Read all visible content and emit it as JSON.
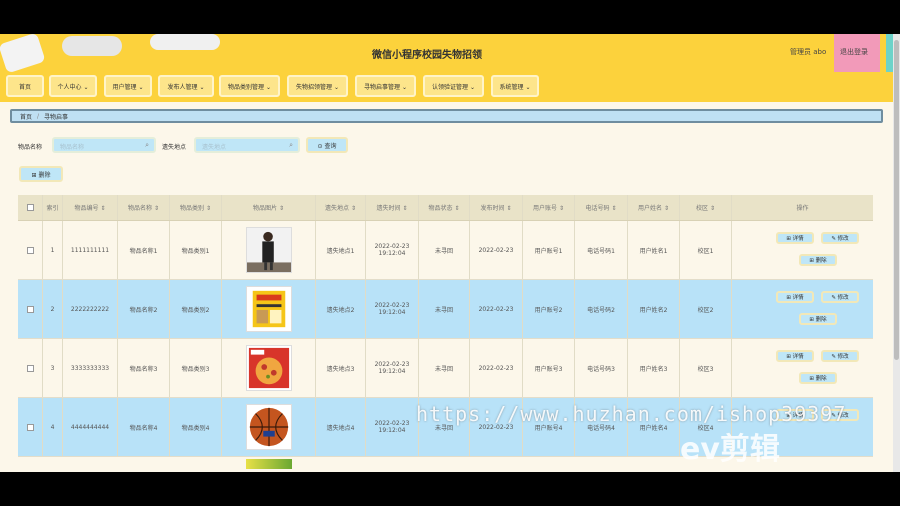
{
  "header": {
    "title": "微信小程序校园失物招领",
    "admin": "管理员 abo",
    "logout": "退出登录"
  },
  "nav": [
    "首页",
    "个人中心 ⌄",
    "用户管理 ⌄",
    "发布人管理 ⌄",
    "物品类别管理 ⌄",
    "失物招领管理 ⌄",
    "寻物启事管理 ⌄",
    "认领验证管理 ⌄",
    "系统管理 ⌄"
  ],
  "breadcrumb": {
    "home": "首页",
    "current": "寻物启事"
  },
  "filters": {
    "name_label": "物品名称",
    "name_placeholder": "物品名称",
    "place_label": "遗失地点",
    "place_placeholder": "遗失地点",
    "query": "⊙ 查询",
    "delete": "⊞ 删除"
  },
  "table": {
    "headers": [
      "索引",
      "物品编号 ⇕",
      "物品名称 ⇕",
      "物品类别 ⇕",
      "物品图片 ⇕",
      "遗失地点 ⇕",
      "遗失时间 ⇕",
      "物品状态 ⇕",
      "发布时间 ⇕",
      "用户账号 ⇕",
      "电话号码 ⇕",
      "用户姓名 ⇕",
      "校区 ⇕",
      "操作"
    ],
    "rows": [
      {
        "index": "1",
        "code": "1111111111",
        "name": "物品名称1",
        "category": "物品类别1",
        "place": "遗失地点1",
        "lost_date": "2022-02-23",
        "lost_time": "19:12:04",
        "status": "未寻回",
        "publish": "2022-02-23",
        "account": "用户账号1",
        "phone": "电话号码1",
        "uname": "用户姓名1",
        "campus": "校区1"
      },
      {
        "index": "2",
        "code": "2222222222",
        "name": "物品名称2",
        "category": "物品类别2",
        "place": "遗失地点2",
        "lost_date": "2022-02-23",
        "lost_time": "19:12:04",
        "status": "未寻回",
        "publish": "2022-02-23",
        "account": "用户账号2",
        "phone": "电话号码2",
        "uname": "用户姓名2",
        "campus": "校区2"
      },
      {
        "index": "3",
        "code": "3333333333",
        "name": "物品名称3",
        "category": "物品类别3",
        "place": "遗失地点3",
        "lost_date": "2022-02-23",
        "lost_time": "19:12:04",
        "status": "未寻回",
        "publish": "2022-02-23",
        "account": "用户账号3",
        "phone": "电话号码3",
        "uname": "用户姓名3",
        "campus": "校区3"
      },
      {
        "index": "4",
        "code": "4444444444",
        "name": "物品名称4",
        "category": "物品类别4",
        "place": "遗失地点4",
        "lost_date": "2022-02-23",
        "lost_time": "19:12:04",
        "status": "未寻回",
        "publish": "2022-02-23",
        "account": "用户账号4",
        "phone": "电话号码4",
        "uname": "用户姓名4",
        "campus": "校区4"
      }
    ],
    "actions": {
      "detail": "⊞ 详情",
      "edit": "✎ 修改",
      "delete": "⊞ 删除"
    }
  },
  "overlay": {
    "watermark": "https://www.huzhan.com/ishop39397",
    "logo": "ev剪辑"
  },
  "colors": {
    "header_yellow": "#fcd23c",
    "highlight_row": "#b8e2f8",
    "button_blue": "#bfe6f7"
  }
}
